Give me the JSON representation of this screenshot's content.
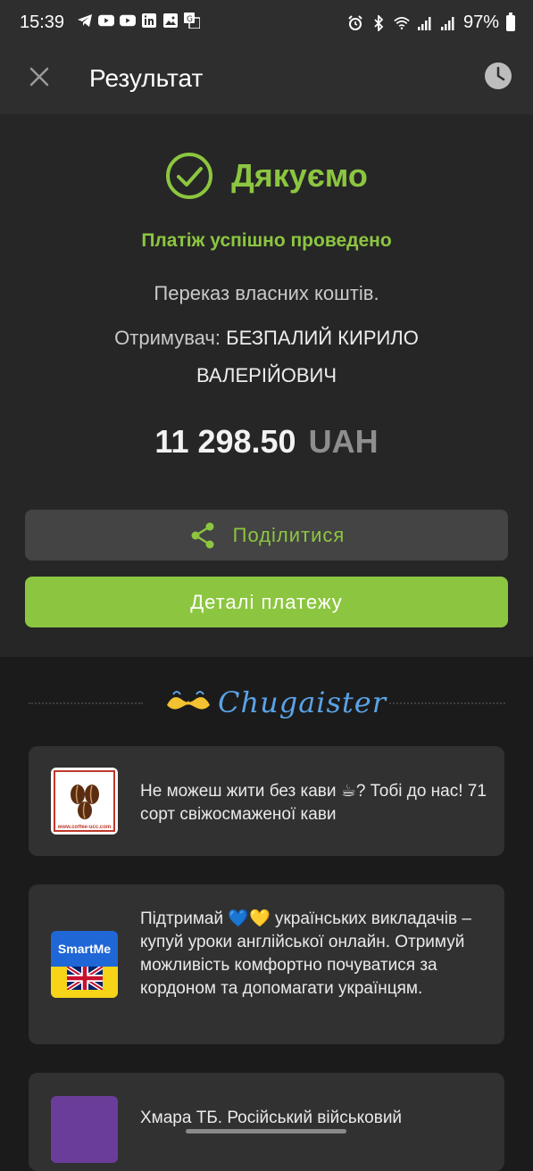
{
  "status_bar": {
    "time": "15:39",
    "battery": "97%",
    "left_icons": [
      "telegram-icon",
      "youtube-icon",
      "youtube-icon",
      "linkedin-icon",
      "gallery-icon",
      "translate-icon"
    ],
    "right_icons": [
      "alarm-icon",
      "bluetooth-icon",
      "wifi-icon",
      "signal-icon",
      "signal-icon",
      "battery-icon"
    ]
  },
  "app_bar": {
    "title": "Результат",
    "close_icon": "close-icon",
    "history_icon": "clock-icon"
  },
  "result": {
    "thanks": "Дякуємо",
    "success": "Платіж успішно проведено",
    "description": "Переказ власних коштів.",
    "recipient_label": "Отримувач:",
    "recipient_name": "БЕЗПАЛИЙ КИРИЛО ВАЛЕРІЙОВИЧ",
    "amount": "11 298.50",
    "currency": "UAH",
    "share_label": "Поділитися",
    "details_label": "Деталі платежу"
  },
  "promo": {
    "brand": "Chugaister",
    "cards": [
      {
        "text": "Не можеш жити без кави ☕? Тобі до нас! 71 сорт свіжосмаженої кави",
        "thumb_url": "www.coffee-ucc.com"
      },
      {
        "text": "Підтримай 💙💛 українських викладачів – купуй уроки англійської онлайн. Отримуй можливість комфортно почуватися за кордоном та допомагати українцям.",
        "thumb_label": "SmartMe"
      },
      {
        "text": "Хмара ТБ. Російський військовий"
      }
    ]
  },
  "colors": {
    "accent": "#8cc640",
    "background": "#1b1b1b",
    "panel": "#262626",
    "card": "#313131",
    "brand_blue": "#5aa3e6",
    "brand_yellow": "#f2c230"
  }
}
